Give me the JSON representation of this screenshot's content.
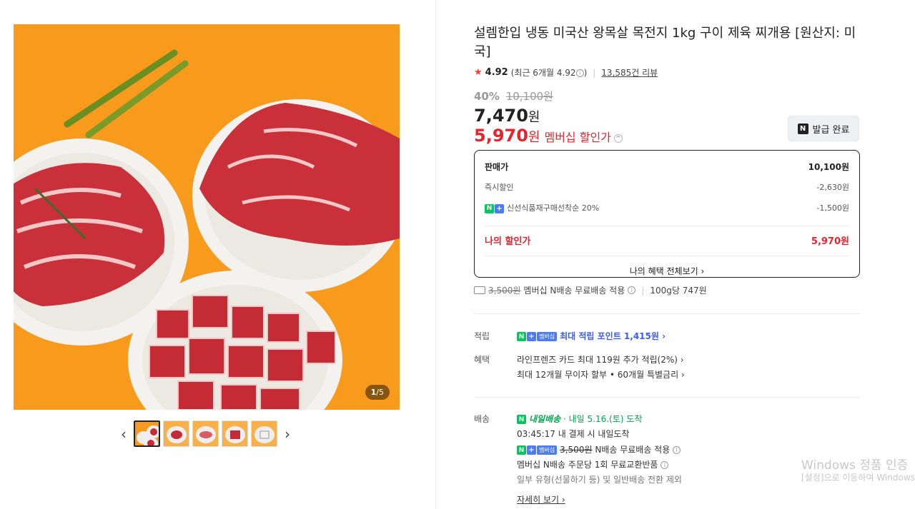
{
  "gallery": {
    "counter_current": "1",
    "counter_total": "5",
    "counter_sep": "/",
    "prev_icon": "‹",
    "next_icon": "›"
  },
  "product": {
    "title": "설렘한입 냉동 미국산 왕목살 목전지 1kg 구이 제육 찌개용 [원산지: 미국]",
    "rating": "4.92",
    "rating_recent": "(최근 6개월 4.92",
    "rating_recent_close": ")",
    "review_count": "13,585건 리뷰",
    "discount_pct": "40%",
    "original_price": "10,100원",
    "price": "7,470",
    "price_unit": "원",
    "member_price": "5,970",
    "member_price_unit": "원",
    "member_label": "멤버십 할인가",
    "coupon_button": "발급 완료"
  },
  "price_box": {
    "sale_label": "판매가",
    "sale_value": "10,100원",
    "instant_label": "즉시할인",
    "instant_value": "-2,630원",
    "fresh_label": "신선식품재구매선착순 20%",
    "fresh_value": "-1,500원",
    "my_label": "나의 할인가",
    "my_value": "5,970원",
    "more_link": "나의 혜택 전체보기 ›"
  },
  "shipping_summary": {
    "strike_fee": "3,500원",
    "text": "멤버십 N배송 무료배송 적용",
    "per_100g": "100g당 747원"
  },
  "benefits": {
    "reward_label": "적립",
    "reward_badge": "멤버십",
    "reward_text": "최대 적립 포인트 1,415원 ›",
    "benefit_label": "혜택",
    "benefit_line1": "라인프렌즈 카드 최대 119원 추가 적립(2%) ›",
    "benefit_line2": "최대 12개월 무이자 할부 • 60개월 특별금리 ›"
  },
  "delivery": {
    "label": "배송",
    "tag": "내일배송",
    "arrival": "· 내일 5.16.(토) 도착",
    "cutoff": "03:45:17  내 결제 시 내일도착",
    "badge": "멤버십",
    "strike_fee": "3,500원",
    "free_text": "N배송 무료배송 적용",
    "exchange": "멤버십 N배송 주문당 1회 무료교환반품",
    "exclusion": "일부 유형(선물하기 등) 및 일반배송 전환 제외",
    "detail_link": "자세히 보기 ›"
  },
  "watermark": {
    "line1": "Windows 정품 인증",
    "line2": "[설정]으로 이동하여 Windows"
  },
  "colors": {
    "accent_red": "#e5242e",
    "npay_green": "#03c75a",
    "link_blue": "#3d5bf6",
    "image_bg": "#f89a1c"
  }
}
